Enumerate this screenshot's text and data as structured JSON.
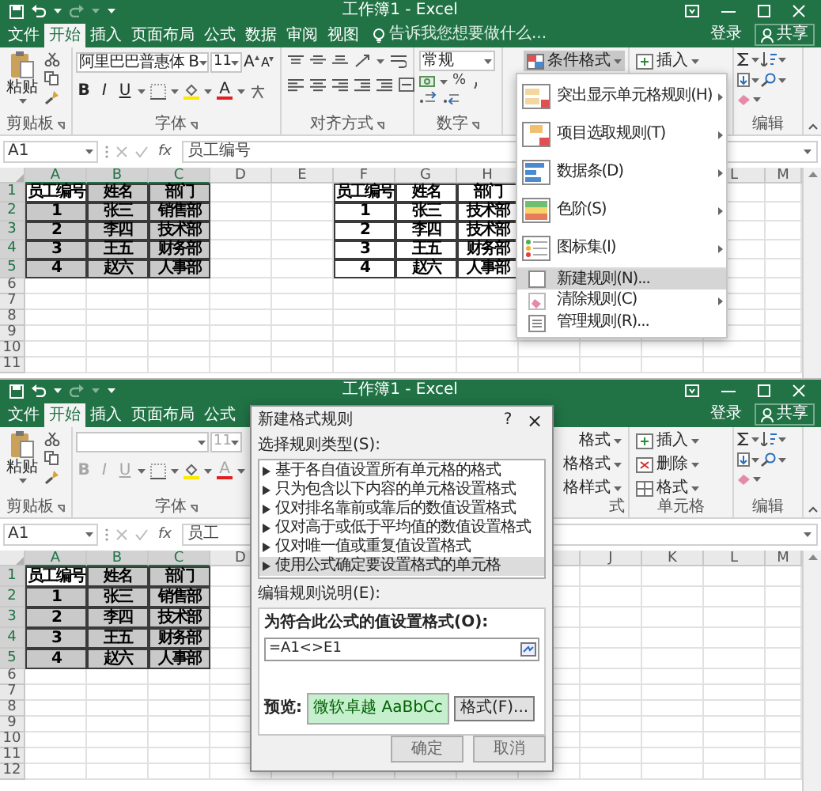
{
  "windows": [
    {
      "title": "工作簿1 - Excel",
      "tabs": [
        {
          "label": "文件",
          "selected": false
        },
        {
          "label": "开始",
          "selected": true
        },
        {
          "label": "插入",
          "selected": false
        },
        {
          "label": "页面布局",
          "selected": false
        },
        {
          "label": "公式",
          "selected": false
        },
        {
          "label": "数据",
          "selected": false
        },
        {
          "label": "审阅",
          "selected": false
        },
        {
          "label": "视图",
          "selected": false
        }
      ],
      "tell_me": "告诉我您想要做什么...",
      "sign_in": "登录",
      "share": "共享",
      "ribbon": {
        "paste": "粘贴",
        "font_enabled": true,
        "font_name": "阿里巴巴普惠体 B",
        "font_size": "11",
        "grow_font": "A",
        "shrink_font": "A",
        "bold": "B",
        "italic": "I",
        "underline": "U",
        "font_color": "A",
        "number_format": "常规",
        "percent": "%",
        "style_items": [
          {
            "label": "条件格式",
            "kind": "full",
            "pressed": true
          }
        ],
        "cell_items": [
          "插入"
        ],
        "group_labels": {
          "clipboard": "剪贴板",
          "font": "字体",
          "alignment": "对齐方式",
          "number": "数字",
          "editing": "编辑"
        }
      },
      "name_box": "A1",
      "function_label": "fx",
      "formula": "员工编号",
      "grid": {
        "columns": [
          {
            "label": "A",
            "selected": true
          },
          {
            "label": "B",
            "selected": true
          },
          {
            "label": "C",
            "selected": true
          },
          {
            "label": "D",
            "selected": false
          },
          {
            "label": "E",
            "selected": false
          },
          {
            "label": "F",
            "selected": false
          },
          {
            "label": "G",
            "selected": false
          },
          {
            "label": "H",
            "selected": false
          },
          null,
          null,
          null,
          {
            "label": "L",
            "selected": false
          },
          {
            "label": "M",
            "selected": false
          }
        ],
        "rows": [
          {
            "header": "1",
            "selected": true,
            "cells": [
              {
                "text": "员工编号",
                "selected": false
              },
              {
                "text": "姓名",
                "selected": true
              },
              {
                "text": "部门",
                "selected": true
              },
              null,
              null,
              {
                "text": "员工编号",
                "selected": false
              },
              {
                "text": "姓名",
                "selected": false
              },
              {
                "text": "部门",
                "selected": false
              }
            ]
          },
          {
            "header": "2",
            "selected": true,
            "cells": [
              {
                "text": "1",
                "selected": true
              },
              {
                "text": "张三",
                "selected": true
              },
              {
                "text": "销售部",
                "selected": true
              },
              null,
              null,
              {
                "text": "1",
                "selected": false
              },
              {
                "text": "张三",
                "selected": false
              },
              {
                "text": "技术部",
                "selected": false
              }
            ]
          },
          {
            "header": "3",
            "selected": true,
            "cells": [
              {
                "text": "2",
                "selected": true
              },
              {
                "text": "李四",
                "selected": true
              },
              {
                "text": "技术部",
                "selected": true
              },
              null,
              null,
              {
                "text": "2",
                "selected": false
              },
              {
                "text": "李四",
                "selected": false
              },
              {
                "text": "技术部",
                "selected": false
              }
            ]
          },
          {
            "header": "4",
            "selected": true,
            "cells": [
              {
                "text": "3",
                "selected": true
              },
              {
                "text": "王五",
                "selected": true
              },
              {
                "text": "财务部",
                "selected": true
              },
              null,
              null,
              {
                "text": "3",
                "selected": false
              },
              {
                "text": "王五",
                "selected": false
              },
              {
                "text": "财务部",
                "selected": false
              }
            ]
          },
          {
            "header": "5",
            "selected": true,
            "cells": [
              {
                "text": "4",
                "selected": true
              },
              {
                "text": "赵六",
                "selected": true
              },
              {
                "text": "人事部",
                "selected": true
              },
              null,
              null,
              {
                "text": "4",
                "selected": false
              },
              {
                "text": "赵六",
                "selected": false
              },
              {
                "text": "人事部",
                "selected": false
              }
            ]
          },
          {
            "header": "6",
            "selected": false
          },
          {
            "header": "7",
            "selected": false
          },
          {
            "header": "8",
            "selected": false
          },
          {
            "header": "9",
            "selected": false
          },
          {
            "header": "10",
            "selected": false
          },
          {
            "header": "11",
            "selected": false
          }
        ]
      },
      "menu": {
        "items": [
          {
            "label": "突出显示单元格规则(H)",
            "kind": "large",
            "submenu": true,
            "highlighted": false
          },
          {
            "label": "项目选取规则(T)",
            "kind": "large",
            "submenu": true,
            "highlighted": false
          },
          {
            "label": "数据条(D)",
            "kind": "large",
            "submenu": true,
            "highlighted": false
          },
          {
            "label": "色阶(S)",
            "kind": "large",
            "submenu": true,
            "highlighted": false
          },
          {
            "label": "图标集(I)",
            "kind": "large",
            "submenu": true,
            "highlighted": false
          },
          {
            "label": "新建规则(N)...",
            "kind": "small",
            "submenu": false,
            "highlighted": true
          },
          {
            "label": "清除规则(C)",
            "kind": "small",
            "submenu": true,
            "highlighted": false
          },
          {
            "label": "管理规则(R)...",
            "kind": "small",
            "submenu": false,
            "highlighted": false
          }
        ]
      }
    },
    {
      "title": "工作簿1 - Excel",
      "tabs": [
        {
          "label": "文件",
          "selected": false
        },
        {
          "label": "开始",
          "selected": true
        },
        {
          "label": "插入",
          "selected": false
        },
        {
          "label": "页面布局",
          "selected": false
        },
        {
          "label": "公式",
          "selected": false
        }
      ],
      "sign_in": "登录",
      "share": "共享",
      "ribbon": {
        "paste": "粘贴",
        "font_enabled": false,
        "font_size": "11",
        "bold": "B",
        "italic": "I",
        "underline": "U",
        "font_color": "A",
        "style_items": [
          {
            "label": "格式",
            "kind": "cut",
            "pressed": false
          },
          {
            "label": "格格式",
            "kind": "cut",
            "pressed": false
          },
          {
            "label": "格样式",
            "kind": "cut",
            "pressed": false
          }
        ],
        "cell_items": [
          "插入",
          "删除",
          "格式"
        ],
        "group_labels": {
          "clipboard": "剪贴板",
          "font": "字体",
          "styles": "式",
          "cells": "单元格",
          "editing": "编辑"
        }
      },
      "name_box": "A1",
      "function_label": "fx",
      "formula": "员工",
      "grid": {
        "columns": [
          {
            "label": "A",
            "selected": true
          },
          {
            "label": "B",
            "selected": true
          },
          {
            "label": "C",
            "selected": true
          },
          {
            "label": "D",
            "selected": false
          },
          null,
          null,
          null,
          null,
          null,
          {
            "label": "J",
            "selected": false
          },
          {
            "label": "K",
            "selected": false
          },
          {
            "label": "L",
            "selected": false
          },
          {
            "label": "M",
            "selected": false
          }
        ],
        "rows": [
          {
            "header": "1",
            "selected": true,
            "cells": [
              {
                "text": "员工编号",
                "selected": false
              },
              {
                "text": "姓名",
                "selected": true
              },
              {
                "text": "部门",
                "selected": true
              }
            ]
          },
          {
            "header": "2",
            "selected": true,
            "cells": [
              {
                "text": "1",
                "selected": true
              },
              {
                "text": "张三",
                "selected": true
              },
              {
                "text": "销售部",
                "selected": true
              }
            ]
          },
          {
            "header": "3",
            "selected": true,
            "cells": [
              {
                "text": "2",
                "selected": true
              },
              {
                "text": "李四",
                "selected": true
              },
              {
                "text": "技术部",
                "selected": true
              }
            ]
          },
          {
            "header": "4",
            "selected": true,
            "cells": [
              {
                "text": "3",
                "selected": true
              },
              {
                "text": "王五",
                "selected": true
              },
              {
                "text": "财务部",
                "selected": true
              }
            ]
          },
          {
            "header": "5",
            "selected": true,
            "cells": [
              {
                "text": "4",
                "selected": true
              },
              {
                "text": "赵六",
                "selected": true
              },
              {
                "text": "人事部",
                "selected": true
              }
            ]
          },
          {
            "header": "6",
            "selected": false
          },
          {
            "header": "7",
            "selected": false
          },
          {
            "header": "8",
            "selected": false
          },
          {
            "header": "9",
            "selected": false
          },
          {
            "header": "10",
            "selected": false
          },
          {
            "header": "11",
            "selected": false
          },
          {
            "header": "12",
            "selected": false
          }
        ]
      },
      "dialog": {
        "title": "新建格式规则",
        "help": "?",
        "close": "×",
        "rule_type_label": "选择规则类型(S):",
        "rule_types": [
          {
            "label": "基于各自值设置所有单元格的格式",
            "selected": false
          },
          {
            "label": "只为包含以下内容的单元格设置格式",
            "selected": false
          },
          {
            "label": "仅对排名靠前或靠后的数值设置格式",
            "selected": false
          },
          {
            "label": "仅对高于或低于平均值的数值设置格式",
            "selected": false
          },
          {
            "label": "仅对唯一值或重复值设置格式",
            "selected": false
          },
          {
            "label": "使用公式确定要设置格式的单元格",
            "selected": true
          }
        ],
        "description_label": "编辑规则说明(E):",
        "formula_label": "为符合此公式的值设置格式(O):",
        "formula": "=A1<>E1",
        "preview_label": "预览:",
        "preview_text": "微软卓越 AaBbCc",
        "format_button": "格式(F)...",
        "ok": "确定",
        "cancel": "取消"
      }
    }
  ]
}
